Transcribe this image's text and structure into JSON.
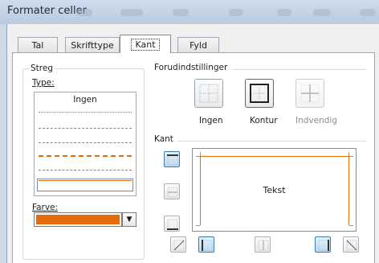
{
  "window": {
    "title": "Formater celler"
  },
  "tabs": [
    {
      "label": "Tal",
      "active": false
    },
    {
      "label": "Skrifttype",
      "active": false
    },
    {
      "label": "Kant",
      "active": true
    },
    {
      "label": "Fyld",
      "active": false
    }
  ],
  "line_group": {
    "title": "Streg",
    "type_label": "Type:",
    "none_label": "Ingen",
    "color_label": "Farve:",
    "selected_color": "#e46c0a"
  },
  "presets": {
    "title": "Forudindstillinger",
    "items": [
      {
        "label": "Ingen",
        "enabled": true
      },
      {
        "label": "Kontur",
        "enabled": true
      },
      {
        "label": "Indvendig",
        "enabled": false
      }
    ]
  },
  "border": {
    "title": "Kant",
    "preview_text": "Tekst"
  },
  "colors": {
    "accent": "#e46c0a",
    "active_button": "#b8daf3"
  }
}
